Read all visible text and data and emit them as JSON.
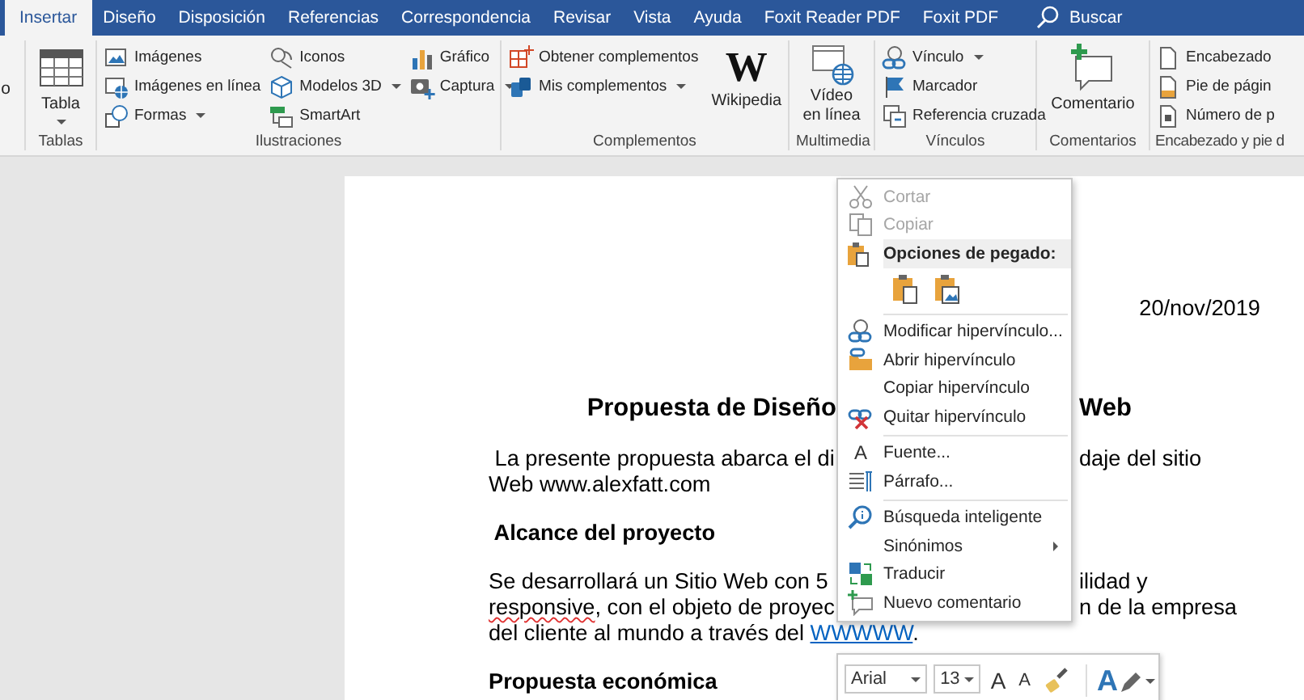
{
  "tabs": [
    {
      "label": "Insertar",
      "selected": true
    },
    {
      "label": "Diseño",
      "selected": false
    },
    {
      "label": "Disposición",
      "selected": false
    },
    {
      "label": "Referencias",
      "selected": false
    },
    {
      "label": "Correspondencia",
      "selected": false
    },
    {
      "label": "Revisar",
      "selected": false
    },
    {
      "label": "Vista",
      "selected": false
    },
    {
      "label": "Ayuda",
      "selected": false
    },
    {
      "label": "Foxit Reader PDF",
      "selected": false
    },
    {
      "label": "Foxit PDF",
      "selected": false
    }
  ],
  "search": {
    "label": "Buscar"
  },
  "ribbon": {
    "groups": [
      {
        "columns": [
          {
            "kind": "cut",
            "label": "o"
          }
        ]
      },
      {
        "label": "Tablas",
        "columns": [
          {
            "kind": "big",
            "label": "Tabla",
            "dropdown": true
          }
        ]
      },
      {
        "label": "Ilustraciones",
        "columns": [
          {
            "kind": "list",
            "items": [
              {
                "label": "Imágenes",
                "dropdown": false
              },
              {
                "label": "Imágenes en línea",
                "dropdown": false
              },
              {
                "label": "Formas",
                "dropdown": true
              }
            ]
          },
          {
            "kind": "list",
            "items": [
              {
                "label": "Iconos",
                "dropdown": false
              },
              {
                "label": "Modelos 3D",
                "dropdown": true
              },
              {
                "label": "SmartArt",
                "dropdown": false
              }
            ]
          },
          {
            "kind": "list",
            "items": [
              {
                "label": "Gráfico",
                "dropdown": false
              },
              {
                "label": "Captura",
                "dropdown": true
              }
            ]
          }
        ]
      },
      {
        "label": "Complementos",
        "columns": [
          {
            "kind": "list",
            "items": [
              {
                "label": "Obtener complementos",
                "dropdown": false
              },
              {
                "label": "Mis complementos",
                "dropdown": true
              }
            ]
          },
          {
            "kind": "big",
            "label": "Wikipedia",
            "glyph": "W",
            "dropdown": false
          }
        ]
      },
      {
        "label": "Multimedia",
        "columns": [
          {
            "kind": "big",
            "label": "Vídeo en línea",
            "dropdown": false
          }
        ]
      },
      {
        "label": "Vínculos",
        "columns": [
          {
            "kind": "list",
            "items": [
              {
                "label": "Vínculo",
                "dropdown": true
              },
              {
                "label": "Marcador",
                "dropdown": false
              },
              {
                "label": "Referencia cruzada",
                "dropdown": false
              }
            ]
          }
        ]
      },
      {
        "label": "Comentarios",
        "columns": [
          {
            "kind": "big",
            "label": "Comentario",
            "dropdown": false
          }
        ]
      },
      {
        "label": "Encabezado y pie d",
        "columns": [
          {
            "kind": "list",
            "items": [
              {
                "label": "Encabezado",
                "dropdown": false
              },
              {
                "label": "Pie de págin",
                "dropdown": false
              },
              {
                "label": "Número de p",
                "dropdown": false
              }
            ]
          }
        ]
      }
    ]
  },
  "document": {
    "blocks": [
      {
        "kind": "date",
        "left": "20/nov/2019"
      },
      {
        "kind": "title",
        "left": "Propuesta de Diseño",
        "right": "Web"
      },
      {
        "kind": "paragraph",
        "lines": [
          {
            "left": [
              {
                "text": " La presente propuesta abarca el di",
                "misspelled": false,
                "link": false
              }
            ],
            "right": "daje del sitio"
          },
          {
            "left": [
              {
                "text": "Web www.alexfatt.com",
                "misspelled": false,
                "link": false
              }
            ]
          }
        ]
      },
      {
        "kind": "heading",
        "left": " Alcance del proyecto"
      },
      {
        "kind": "paragraph",
        "lines": [
          {
            "left": [
              {
                "text": "Se desarrollará un Sitio Web con 5",
                "misspelled": false,
                "link": false
              }
            ],
            "right": "ilidad y"
          },
          {
            "left": [
              {
                "text": "responsive",
                "misspelled": true,
                "link": false
              },
              {
                "text": ", con el objeto de proyec",
                "misspelled": false,
                "link": false
              }
            ],
            "right": "n de la empresa"
          },
          {
            "left": [
              {
                "text": "del cliente al mundo a través del ",
                "misspelled": false,
                "link": false
              },
              {
                "text": "WWWWW",
                "misspelled": false,
                "link": true
              },
              {
                "text": ".",
                "misspelled": false,
                "link": false
              }
            ]
          }
        ]
      },
      {
        "kind": "heading",
        "left": "Propuesta económica"
      }
    ]
  },
  "context_menu": {
    "sections": [
      [
        {
          "kind": "item",
          "label": "Cortar",
          "disabled": true,
          "submenu": false
        },
        {
          "kind": "item",
          "label": "Copiar",
          "disabled": true,
          "submenu": false
        },
        {
          "kind": "header",
          "label": "Opciones de pegado:"
        },
        {
          "kind": "paste-options"
        }
      ],
      [
        {
          "kind": "item",
          "label": "Modificar hipervínculo...",
          "disabled": false,
          "submenu": false
        },
        {
          "kind": "item",
          "label": "Abrir hipervínculo",
          "disabled": false,
          "submenu": false
        },
        {
          "kind": "item",
          "label": "Copiar hipervínculo",
          "disabled": false,
          "submenu": false
        },
        {
          "kind": "item",
          "label": "Quitar hipervínculo",
          "disabled": false,
          "submenu": false
        }
      ],
      [
        {
          "kind": "item",
          "label": "Fuente...",
          "glyph": "A",
          "disabled": false,
          "submenu": false
        },
        {
          "kind": "item",
          "label": "Párrafo...",
          "disabled": false,
          "submenu": false
        }
      ],
      [
        {
          "kind": "item",
          "label": "Búsqueda inteligente",
          "disabled": false,
          "submenu": false
        },
        {
          "kind": "item",
          "label": "Sinónimos",
          "disabled": false,
          "submenu": true
        },
        {
          "kind": "item",
          "label": "Traducir",
          "disabled": false,
          "submenu": false
        },
        {
          "kind": "item",
          "label": "Nuevo comentario",
          "disabled": false,
          "submenu": false
        }
      ]
    ]
  },
  "mini_toolbar": {
    "font": "Arial",
    "size": "13",
    "buttons": [
      {
        "kind": "grow",
        "glyph": "A"
      },
      {
        "kind": "shrink",
        "glyph": "A"
      },
      {
        "kind": "painter"
      },
      {
        "kind": "color",
        "glyph": "A"
      }
    ]
  }
}
